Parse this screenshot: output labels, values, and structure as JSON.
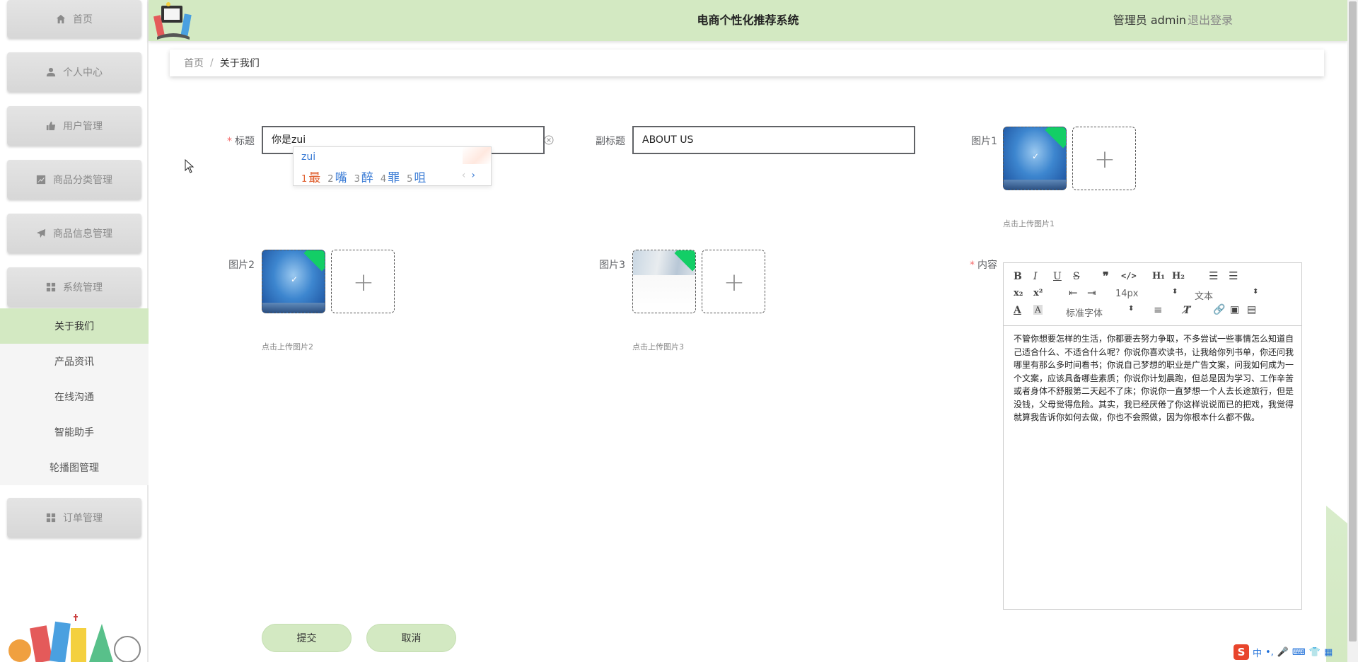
{
  "header": {
    "title": "电商个性化推荐系统",
    "user_label": "管理员 admin",
    "logout_label": "退出登录"
  },
  "sidebar": {
    "menus": [
      {
        "label": "首页",
        "icon": "home-icon"
      },
      {
        "label": "个人中心",
        "icon": "user-icon"
      },
      {
        "label": "用户管理",
        "icon": "thumb-icon"
      },
      {
        "label": "商品分类管理",
        "icon": "chart-icon"
      },
      {
        "label": "商品信息管理",
        "icon": "send-icon"
      },
      {
        "label": "系统管理",
        "icon": "grid-icon"
      },
      {
        "label": "订单管理",
        "icon": "grid-icon"
      }
    ],
    "submenu": [
      {
        "label": "关于我们",
        "active": true
      },
      {
        "label": "产品资讯"
      },
      {
        "label": "在线沟通"
      },
      {
        "label": "智能助手"
      },
      {
        "label": "轮播图管理"
      }
    ]
  },
  "breadcrumb": {
    "home": "首页",
    "separator": "/",
    "current": "关于我们"
  },
  "form": {
    "title_label": "标题",
    "title_value": "你是zui",
    "subtitle_label": "副标题",
    "subtitle_value": "ABOUT US",
    "image1_label": "图片1",
    "image1_tip": "点击上传图片1",
    "image2_label": "图片2",
    "image2_tip": "点击上传图片2",
    "image3_label": "图片3",
    "image3_tip": "点击上传图片3",
    "content_label": "内容",
    "required_mark": "*",
    "upload_check": "✓",
    "upload_plus": "+"
  },
  "ime": {
    "composition": "zui",
    "candidates": [
      {
        "num": "1",
        "text": "最"
      },
      {
        "num": "2",
        "text": "嘴"
      },
      {
        "num": "3",
        "text": "醉"
      },
      {
        "num": "4",
        "text": "罪"
      },
      {
        "num": "5",
        "text": "咀"
      }
    ],
    "prev": "‹",
    "next": "›"
  },
  "editor": {
    "font_size": "14px",
    "text_type": "文本",
    "font_family": "标准字体",
    "content": "不管你想要怎样的生活，你都要去努力争取，不多尝试一些事情怎么知道自己适合什么、不适合什么呢？你说你喜欢读书，让我给你列书单，你还问我哪里有那么多时间看书；你说自己梦想的职业是广告文案，问我如何成为一个文案，应该具备哪些素质；你说你计划晨跑，但总是因为学习、工作辛苦或者身体不舒服第二天起不了床；你说你一直梦想一个人去长途旅行，但是没钱，父母觉得危险。其实，我已经厌倦了你这样说说而已的把戏，我觉得就算我告诉你如何去做，你也不会照做，因为你根本什么都不做。"
  },
  "buttons": {
    "submit": "提交",
    "cancel": "取消"
  },
  "taskbar": {
    "logo": "S",
    "lang": "中",
    "punct": "•,"
  },
  "colors": {
    "accent_green": "#d3e9c2",
    "required_red": "#f56c6c",
    "upload_badge": "#13ce66"
  }
}
